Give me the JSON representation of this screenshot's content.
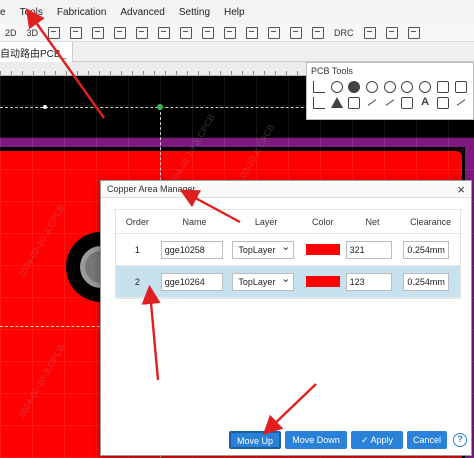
{
  "menu": {
    "items": [
      "e",
      "Tools",
      "Fabrication",
      "Advanced",
      "Setting",
      "Help"
    ]
  },
  "toolbar": {
    "view_2d": "2D",
    "view_3d": "3D",
    "drc_label": "DRC"
  },
  "document_tab": {
    "label": "自动路由PCB_"
  },
  "pcb_tools": {
    "title": "PCB Tools",
    "icons": [
      "track-icon",
      "circle-icon",
      "pin-icon",
      "arc-icon",
      "arc-icon",
      "circle-icon",
      "circle-icon",
      "image-icon",
      "fill-icon",
      "corner-icon",
      "triangle-icon",
      "polygon-icon",
      "line-icon",
      "cross-icon",
      "dimension-icon",
      "text-icon",
      "square-icon",
      "ruler-icon"
    ]
  },
  "watermark": {
    "text": "2024-02-10 JLCPCB"
  },
  "dialog": {
    "title": "Copper Area Manager",
    "close_icon": "close-icon",
    "columns": {
      "order": "Order",
      "name": "Name",
      "layer": "Layer",
      "color": "Color",
      "net": "Net",
      "clearance": "Clearance"
    },
    "rows": [
      {
        "order": "1",
        "name": "gge10258",
        "layer": "TopLayer",
        "color": "#ff0000",
        "net": "321",
        "clearance": "0.254mm",
        "selected": false
      },
      {
        "order": "2",
        "name": "gge10264",
        "layer": "TopLayer",
        "color": "#ff0000",
        "net": "123",
        "clearance": "0.254mm",
        "selected": true
      }
    ],
    "buttons": {
      "move_up": "Move Up",
      "move_down": "Move Down",
      "apply": "Apply",
      "apply_icon": "check-icon",
      "cancel": "Cancel",
      "help": "?"
    }
  },
  "colors": {
    "board": "#ff0000",
    "board_outline": "#7e1a7e",
    "canvas": "#000000",
    "button_primary": "#2a82d8",
    "selected_row": "#c7e1ef",
    "annotation_arrow": "#e02020"
  }
}
